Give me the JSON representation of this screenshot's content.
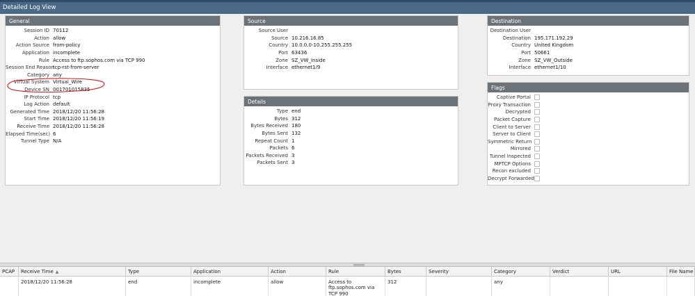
{
  "window": {
    "title": "Detailed Log View"
  },
  "general": {
    "title": "General",
    "rows": [
      {
        "label": "Session ID",
        "value": "70112"
      },
      {
        "label": "Action",
        "value": "allow"
      },
      {
        "label": "Action Source",
        "value": "from-policy"
      },
      {
        "label": "Application",
        "value": "incomplete"
      },
      {
        "label": "Rule",
        "value": "Access to ftp.sophos.com via TCP 990"
      },
      {
        "label": "Session End Reason",
        "value": "tcp-rst-from-server"
      },
      {
        "label": "Category",
        "value": "any"
      },
      {
        "label": "Virtual System",
        "value": "Virtual_Wire"
      },
      {
        "label": "Device SN",
        "value": "001701015835"
      },
      {
        "label": "IP Protocol",
        "value": "tcp"
      },
      {
        "label": "Log Action",
        "value": "default"
      },
      {
        "label": "Generated Time",
        "value": "2018/12/20 11:56:28"
      },
      {
        "label": "Start Time",
        "value": "2018/12/20 11:56:19"
      },
      {
        "label": "Receive Time",
        "value": "2018/12/20 11:56:28"
      },
      {
        "label": "Elapsed Time(sec)",
        "value": "6"
      },
      {
        "label": "Tunnel Type",
        "value": "N/A"
      }
    ]
  },
  "source": {
    "title": "Source",
    "rows": [
      {
        "label": "Source User",
        "value": ""
      },
      {
        "label": "Source",
        "value": "10.216.16.85"
      },
      {
        "label": "Country",
        "value": "10.0.0.0-10.255.255.255"
      },
      {
        "label": "Port",
        "value": "63436"
      },
      {
        "label": "Zone",
        "value": "SZ_VW_Inside"
      },
      {
        "label": "Interface",
        "value": "ethernet1/9"
      }
    ]
  },
  "details": {
    "title": "Details",
    "rows": [
      {
        "label": "Type",
        "value": "end"
      },
      {
        "label": "Bytes",
        "value": "312"
      },
      {
        "label": "Bytes Received",
        "value": "180"
      },
      {
        "label": "Bytes Sent",
        "value": "132"
      },
      {
        "label": "Repeat Count",
        "value": "1"
      },
      {
        "label": "Packets",
        "value": "6"
      },
      {
        "label": "Packets Received",
        "value": "3"
      },
      {
        "label": "Packets Sent",
        "value": "3"
      }
    ]
  },
  "destination": {
    "title": "Destination",
    "rows": [
      {
        "label": "Destination User",
        "value": ""
      },
      {
        "label": "Destination",
        "value": "195.171.192.29"
      },
      {
        "label": "Country",
        "value": "United Kingdom"
      },
      {
        "label": "Port",
        "value": "50661"
      },
      {
        "label": "Zone",
        "value": "SZ_VW_Outside"
      },
      {
        "label": "Interface",
        "value": "ethernet1/10"
      }
    ]
  },
  "flags": {
    "title": "Flags",
    "items": [
      {
        "label": "Captive Portal",
        "checked": false
      },
      {
        "label": "Proxy Transaction",
        "checked": false
      },
      {
        "label": "Decrypted",
        "checked": false
      },
      {
        "label": "Packet Capture",
        "checked": false
      },
      {
        "label": "Client to Server",
        "checked": false
      },
      {
        "label": "Server to Client",
        "checked": false
      },
      {
        "label": "Symmetric Return",
        "checked": false
      },
      {
        "label": "Mirrored",
        "checked": false
      },
      {
        "label": "Tunnel Inspected",
        "checked": false
      },
      {
        "label": "MPTCP Options",
        "checked": false
      },
      {
        "label": "Recon excluded",
        "checked": false
      },
      {
        "label": "Decrypt Forwarded",
        "checked": false
      }
    ]
  },
  "log_table": {
    "columns": [
      "PCAP",
      "Receive Time",
      "Type",
      "Application",
      "Action",
      "Rule",
      "Bytes",
      "Severity",
      "Category",
      "Verdict",
      "URL",
      "File Name"
    ],
    "sorted_column": "Receive Time",
    "sort_direction": "ascending",
    "rows": [
      [
        "",
        "2018/12/20 11:56:28",
        "end",
        "incomplete",
        "allow",
        "Access to ftp.sophos.com via TCP 990",
        "312",
        "",
        "any",
        "",
        "",
        ""
      ]
    ]
  },
  "annotation": {
    "highlighted_field": "Session End Reason",
    "color": "#d11a1a"
  },
  "colors": {
    "titlebar": "#4a6986",
    "panel_header": "#6b7379"
  }
}
